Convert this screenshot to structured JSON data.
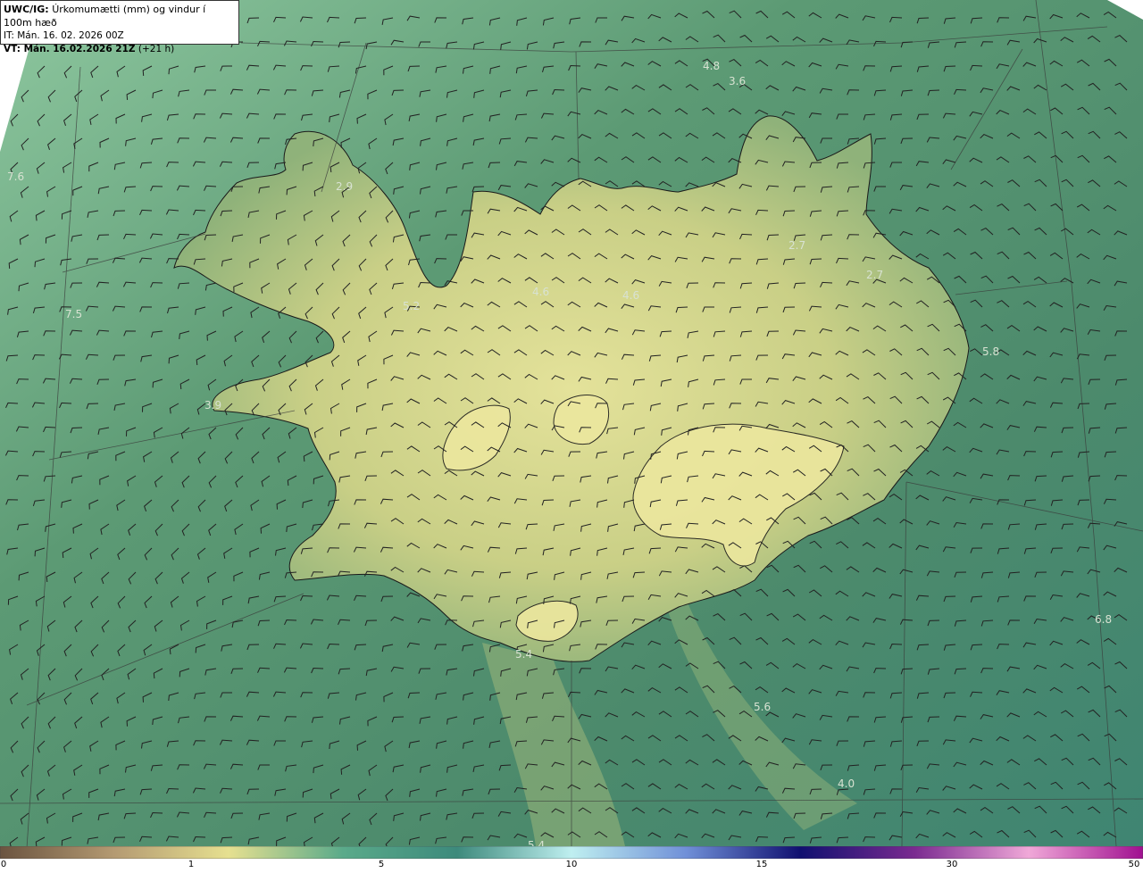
{
  "info": {
    "title_prefix": "UWC/IG:",
    "title_text": "Úrkomumætti (mm) og vindur í 100m hæð",
    "it_line": "IT: Mán. 16. 02. 2026 00Z",
    "vt_prefix": "VT: Mán. 16.02.2026 21Z",
    "vt_suffix": "(+21 h)"
  },
  "value_labels": [
    "4.8",
    "3.6",
    "7.6",
    "2.9",
    "2.7",
    "2.7",
    "4.6",
    "4.6",
    "5.2",
    "7.5",
    "5.8",
    "3.9",
    "5.4",
    "5.6",
    "6.8",
    "4.0",
    "5.4"
  ],
  "colorbar": {
    "ticks": [
      "0",
      "1",
      "5",
      "10",
      "15",
      "30",
      "50"
    ],
    "tick_values": [
      0,
      1,
      5,
      10,
      15,
      30,
      50
    ],
    "colors": [
      "#6b5440",
      "#b49a72",
      "#e6e090",
      "#5aaa8a",
      "#3d8a7c",
      "#bfeff0",
      "#7090d8",
      "#101070",
      "#7a2a90",
      "#f0a8d8",
      "#a01090"
    ]
  },
  "palette": {
    "ocean": "#4f8f6f",
    "land": "#d8d88a",
    "coastline": "#1a1a1a",
    "barb": "#222222",
    "grid": "#3a3a3a"
  }
}
